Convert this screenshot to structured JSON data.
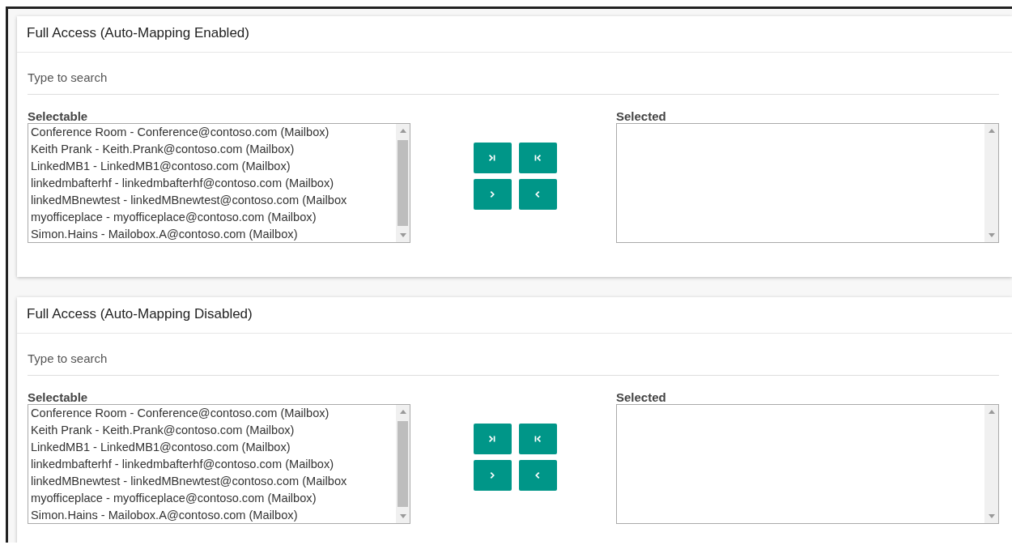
{
  "panels": [
    {
      "title": "Full Access (Auto-Mapping Enabled)",
      "search": {
        "placeholder": "Type to search"
      },
      "selectable": {
        "label": "Selectable",
        "items": [
          "Conference Room - Conference@contoso.com (Mailbox)",
          "Keith Prank - Keith.Prank@contoso.com (Mailbox)",
          "LinkedMB1 - LinkedMB1@contoso.com (Mailbox)",
          "linkedmbafterhf - linkedmbafterhf@contoso.com (Mailbox)",
          "linkedMBnewtest - linkedMBnewtest@contoso.com (Mailbox",
          "myofficeplace - myofficeplace@contoso.com (Mailbox)",
          "Simon.Hains - Mailobox.A@contoso.com (Mailbox)"
        ]
      },
      "selected": {
        "label": "Selected"
      }
    },
    {
      "title": "Full Access (Auto-Mapping Disabled)",
      "search": {
        "placeholder": "Type to search"
      },
      "selectable": {
        "label": "Selectable",
        "items": [
          "Conference Room - Conference@contoso.com (Mailbox)",
          "Keith Prank - Keith.Prank@contoso.com (Mailbox)",
          "LinkedMB1 - LinkedMB1@contoso.com (Mailbox)",
          "linkedmbafterhf - linkedmbafterhf@contoso.com (Mailbox)",
          "linkedMBnewtest - linkedMBnewtest@contoso.com (Mailbox",
          "myofficeplace - myofficeplace@contoso.com (Mailbox)",
          "Simon.Hains - Mailobox.A@contoso.com (Mailbox)"
        ]
      },
      "selected": {
        "label": "Selected"
      }
    }
  ]
}
